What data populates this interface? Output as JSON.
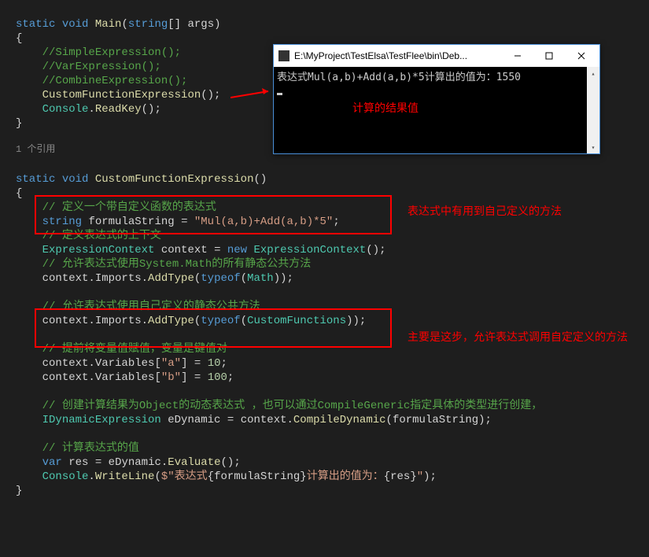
{
  "main": {
    "sig_static": "static",
    "sig_void": "void",
    "sig_name": "Main",
    "sig_params_type": "string",
    "sig_params_name": "args",
    "c1": "//SimpleExpression();",
    "c2": "//VarExpression();",
    "c3": "//CombineExpression();",
    "call1": "CustomFunctionExpression",
    "call2_obj": "Console",
    "call2_m": "ReadKey"
  },
  "refs": "1 个引用",
  "func": {
    "sig_static": "static",
    "sig_void": "void",
    "sig_name": "CustomFunctionExpression",
    "c_define": "// 定义一个带自定义函数的表达式",
    "t_string": "string",
    "v_formula": "formulaString",
    "s_formula": "\"Mul(a,b)+Add(a,b)*5\"",
    "c_context": "// 定义表达式的上下文",
    "t_ctx": "ExpressionContext",
    "v_ctx": "context",
    "kw_new": "new",
    "c_math": "// 允许表达式使用System.Math的所有静态公共方法",
    "p_imports": "Imports",
    "m_addtype": "AddType",
    "kw_typeof": "typeof",
    "t_math": "Math",
    "c_custom": "// 允许表达式使用自己定义的静态公共方法",
    "t_customfn": "CustomFunctions",
    "c_vars": "// 提前将变量值赋值，变量是键值对",
    "p_vars": "Variables",
    "s_a": "\"a\"",
    "n_10": "10",
    "s_b": "\"b\"",
    "n_100": "100",
    "c_create": "// 创建计算结果为Object的动态表达式 ，也可以通过CompileGeneric指定具体的类型进行创建，",
    "t_idyn": "IDynamicExpression",
    "v_edyn": "eDynamic",
    "m_compile": "CompileDynamic",
    "c_calc": "// 计算表达式的值",
    "kw_var": "var",
    "v_res": "res",
    "m_eval": "Evaluate",
    "t_console": "Console",
    "m_writeline": "WriteLine",
    "s_out1": "$\"表达式",
    "s_out2": "计算出的值为：",
    "s_out3": "\""
  },
  "console": {
    "title": "E:\\MyProject\\TestElsa\\TestFlee\\bin\\Deb...",
    "output": "表达式Mul(a,b)+Add(a,b)*5计算出的值为：1550"
  },
  "annotations": {
    "result": "计算的结果值",
    "a1": "表达式中有用到自己定义的方法",
    "a2": "主要是这步，允许表达式调用自定定义的方法"
  }
}
